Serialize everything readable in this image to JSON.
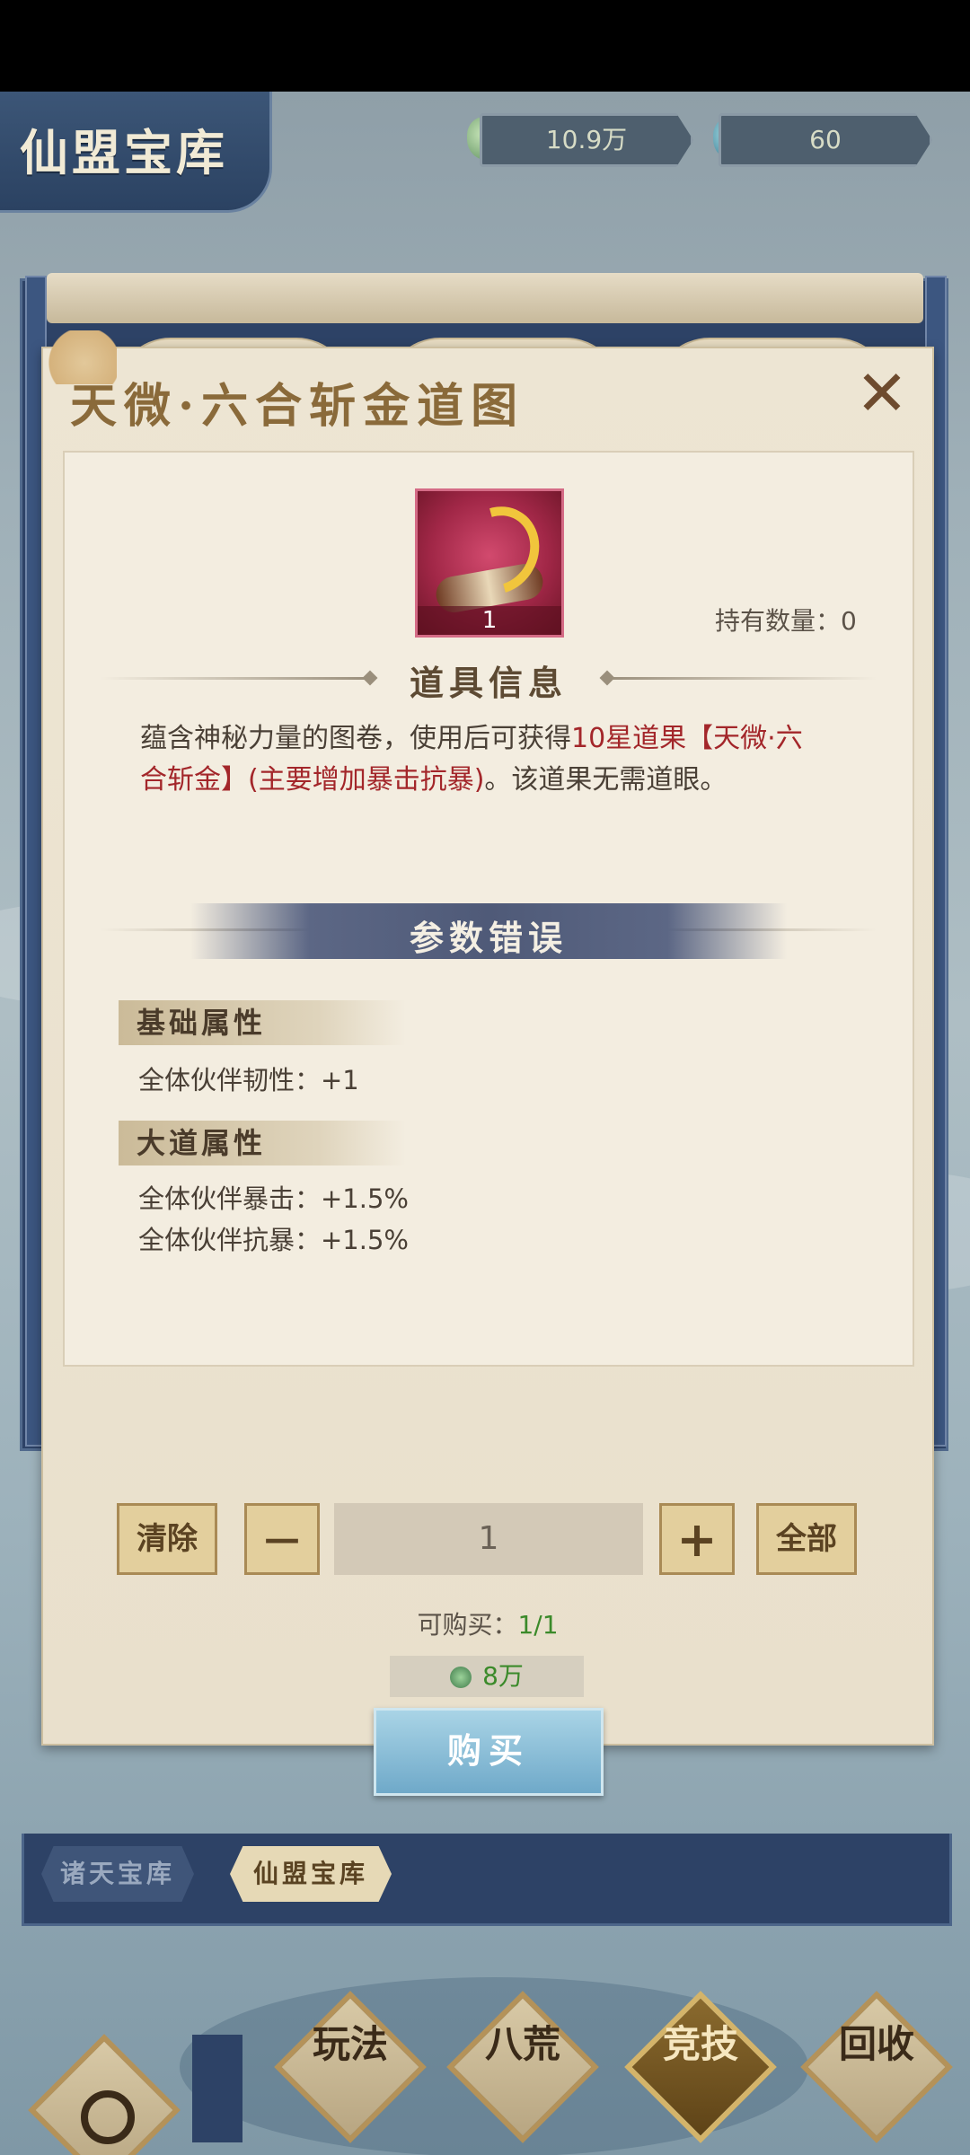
{
  "header": {
    "title": "仙盟宝库",
    "currency1": "10.9万",
    "currency2": "60"
  },
  "dialog": {
    "title": "天微·六合斩金道图",
    "close": "✕",
    "item_count": "1",
    "hold_label": "持有数量：0",
    "section_info": "道具信息",
    "desc_pre": "蕴含神秘力量的图卷，使用后可获得",
    "desc_hl1": "10星道果【天微·六合斩金】(主要增加暴击抗暴)",
    "desc_post": "。该道果无需道眼。",
    "section_error": "参数错误",
    "basic_title": "基础属性",
    "basic_attr": "全体伙伴韧性：+1",
    "dao_title": "大道属性",
    "dao_attr1": "全体伙伴暴击：+1.5%",
    "dao_attr2": "全体伙伴抗暴：+1.5%",
    "clear_label": "清除",
    "minus_label": "—",
    "quantity": "1",
    "plus_label": "+",
    "all_label": "全部",
    "buy_limit_label": "可购买：",
    "buy_limit_value": "1/1",
    "price": "8万",
    "buy_label": "购买"
  },
  "tabs": [
    "诸天宝库",
    "仙盟宝库"
  ],
  "nav": [
    "玩法",
    "八荒",
    "竞技",
    "回收"
  ],
  "colors": {
    "highlight_red": "#a3262a",
    "green": "#3b8a2a",
    "navy": "#2d4266"
  }
}
